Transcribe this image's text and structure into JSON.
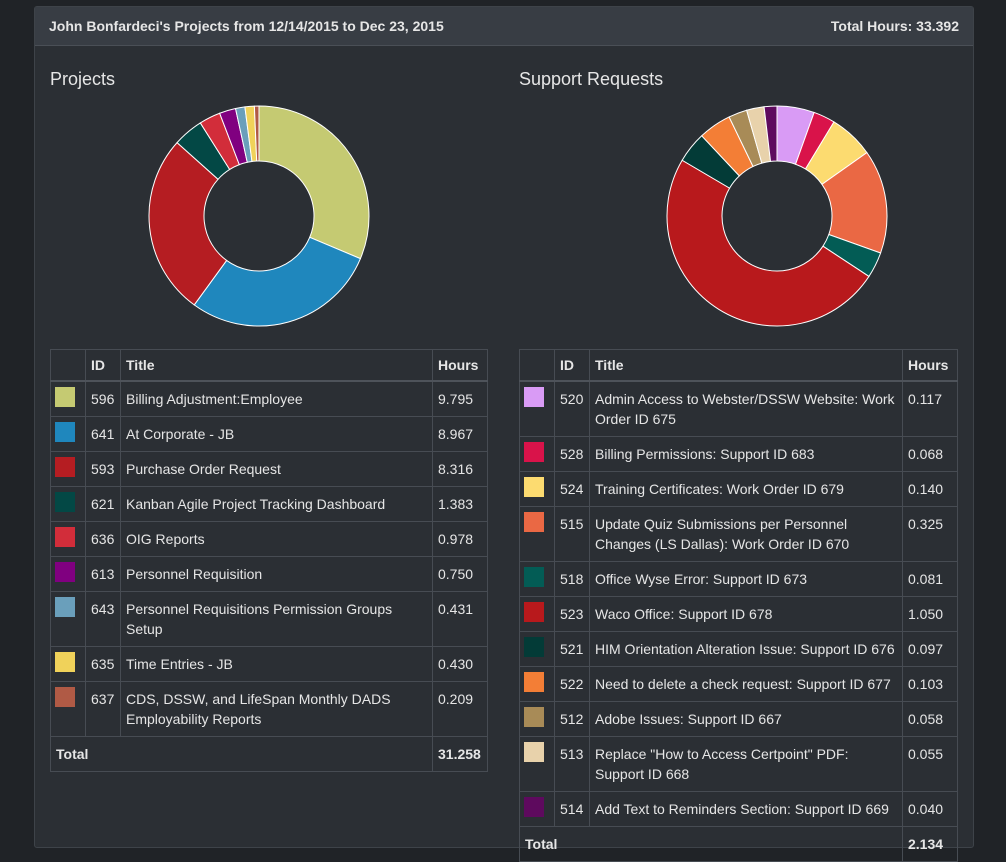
{
  "header": {
    "title": "John Bonfardeci's Projects from 12/14/2015 to Dec 23, 2015",
    "total_hours": "Total Hours: 33.392"
  },
  "projects": {
    "heading": "Projects",
    "columns": {
      "id": "ID",
      "title": "Title",
      "hours": "Hours"
    },
    "rows": [
      {
        "id": "596",
        "title": "Billing Adjustment:Employee",
        "hours": "9.795",
        "color": "#c5ca72"
      },
      {
        "id": "641",
        "title": "At Corporate - JB",
        "hours": "8.967",
        "color": "#1f87bd"
      },
      {
        "id": "593",
        "title": "Purchase Order Request",
        "hours": "8.316",
        "color": "#b51d22"
      },
      {
        "id": "621",
        "title": "Kanban Agile Project Tracking Dashboard",
        "hours": "1.383",
        "color": "#034845"
      },
      {
        "id": "636",
        "title": "OIG Reports",
        "hours": "0.978",
        "color": "#d22d3a"
      },
      {
        "id": "613",
        "title": "Personnel Requisition",
        "hours": "0.750",
        "color": "#800080"
      },
      {
        "id": "643",
        "title": "Personnel Requisitions Permission Groups Setup",
        "hours": "0.431",
        "color": "#6a9fbb"
      },
      {
        "id": "635",
        "title": "Time Entries - JB",
        "hours": "0.430",
        "color": "#f0d25a"
      },
      {
        "id": "637",
        "title": "CDS, DSSW, and LifeSpan Monthly DADS Employability Reports",
        "hours": "0.209",
        "color": "#b05a45"
      }
    ],
    "total_label": "Total",
    "total_value": "31.258"
  },
  "support": {
    "heading": "Support Requests",
    "columns": {
      "id": "ID",
      "title": "Title",
      "hours": "Hours"
    },
    "rows": [
      {
        "id": "520",
        "title": "Admin Access to Webster/DSSW Website: Work Order ID 675",
        "hours": "0.117",
        "color": "#d99bf5"
      },
      {
        "id": "528",
        "title": "Billing Permissions: Support ID 683",
        "hours": "0.068",
        "color": "#d9134a"
      },
      {
        "id": "524",
        "title": "Training Certificates: Work Order ID 679",
        "hours": "0.140",
        "color": "#fcdb70"
      },
      {
        "id": "515",
        "title": "Update Quiz Submissions per Personnel Changes (LS Dallas): Work Order ID 670",
        "hours": "0.325",
        "color": "#ea6844"
      },
      {
        "id": "518",
        "title": "Office Wyse Error: Support ID 673",
        "hours": "0.081",
        "color": "#035c55"
      },
      {
        "id": "523",
        "title": "Waco Office: Support ID 678",
        "hours": "1.050",
        "color": "#b8191c"
      },
      {
        "id": "521",
        "title": "HIM Orientation Alteration Issue: Support ID 676",
        "hours": "0.097",
        "color": "#033b37"
      },
      {
        "id": "522",
        "title": "Need to delete a check request: Support ID 677",
        "hours": "0.103",
        "color": "#f37e36"
      },
      {
        "id": "512",
        "title": "Adobe Issues: Support ID 667",
        "hours": "0.058",
        "color": "#a88b57"
      },
      {
        "id": "513",
        "title": "Replace \"How to Access Certpoint\" PDF: Support ID 668",
        "hours": "0.055",
        "color": "#e8d2ab"
      },
      {
        "id": "514",
        "title": "Add Text to Reminders Section: Support ID 669",
        "hours": "0.040",
        "color": "#5e0a5e"
      }
    ],
    "total_label": "Total",
    "total_value": "2.134"
  },
  "chart_data": [
    {
      "type": "pie",
      "categories": [
        "596",
        "641",
        "593",
        "621",
        "636",
        "613",
        "643",
        "635",
        "637"
      ],
      "values": [
        9.795,
        8.967,
        8.316,
        1.383,
        0.978,
        0.75,
        0.431,
        0.43,
        0.209
      ]
    },
    {
      "type": "pie",
      "categories": [
        "520",
        "528",
        "524",
        "515",
        "518",
        "523",
        "521",
        "522",
        "512",
        "513",
        "514"
      ],
      "values": [
        0.117,
        0.068,
        0.14,
        0.325,
        0.081,
        1.05,
        0.097,
        0.103,
        0.058,
        0.055,
        0.04
      ]
    }
  ]
}
